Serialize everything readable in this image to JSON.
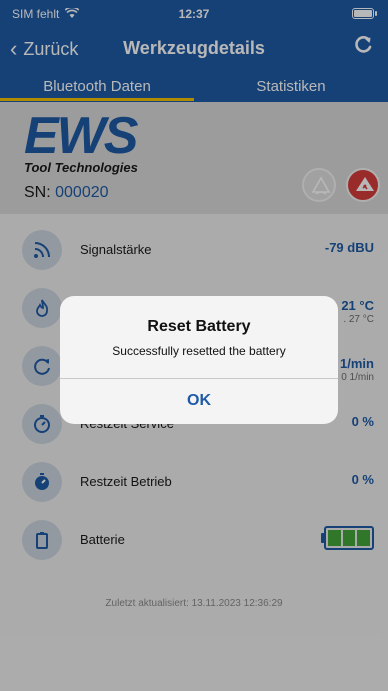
{
  "status_bar": {
    "carrier": "SIM fehlt",
    "wifi_icon": "wifi-icon",
    "time": "12:37",
    "battery_icon": "battery-icon"
  },
  "nav": {
    "back_label": "Zurück",
    "title": "Werkzeugdetails",
    "refresh_icon": "refresh-icon"
  },
  "tabs": [
    {
      "label": "Bluetooth Daten",
      "active": true
    },
    {
      "label": "Statistiken",
      "active": false
    }
  ],
  "header": {
    "logo_text": "EWS",
    "logo_subtext": "Tool Technologies",
    "sn_label": "SN:",
    "sn_value": "000020"
  },
  "rows": [
    {
      "label": "Signalstärke",
      "value": "-79 dBU",
      "sub": "",
      "icon": "signal-icon"
    },
    {
      "label": "",
      "value": "21 °C",
      "sub": ". 27 °C",
      "icon": "flame-icon"
    },
    {
      "label": "",
      "value": "1/min",
      "sub": "0 1/min",
      "icon": "rotation-icon"
    },
    {
      "label": "Restzeit Service",
      "value": "0 %",
      "sub": "",
      "icon": "service-timer-icon"
    },
    {
      "label": "Restzeit Betrieb",
      "value": "0 %",
      "sub": "",
      "icon": "operation-timer-icon"
    },
    {
      "label": "Batterie",
      "value": "",
      "sub": "",
      "icon": "battery-icon"
    }
  ],
  "battery_level": 1.0,
  "updated": "Zuletzt aktualisiert: 13.11.2023 12:36:29",
  "alert": {
    "title": "Reset Battery",
    "message": "Successfully resetted the battery",
    "ok_label": "OK"
  },
  "colors": {
    "primary": "#1f5aa6",
    "accent": "#f3c200",
    "battery_green": "#44a53a",
    "alert_red": "#d63c3c"
  }
}
